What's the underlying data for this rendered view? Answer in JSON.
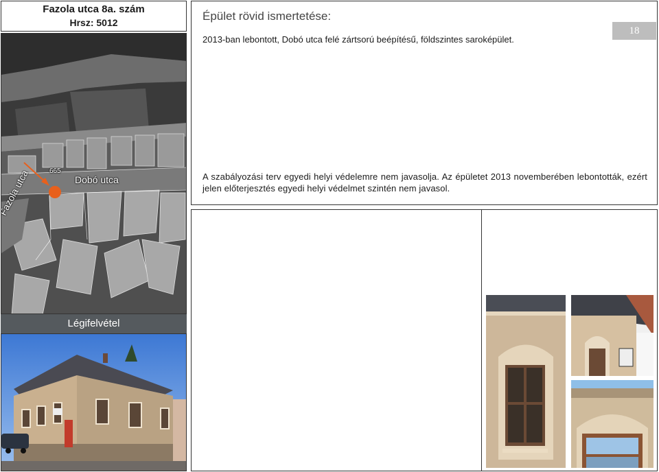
{
  "header": {
    "address": "Fazola utca 8a. szám",
    "lot_number": "Hrsz: 5012"
  },
  "aerial": {
    "labels": {
      "street_dobo": "Dobó utca",
      "street_fazola": "Fazola utca",
      "parcel_665": "665"
    },
    "caption": "Légifelvétel",
    "marker_color": "#e8601c"
  },
  "description": {
    "heading": "Épület rövid ismertetése:",
    "text": "2013-ban lebontott, Dobó utca felé zártsorú beépítésű, földszintes saroképület.",
    "page_number": "18",
    "protection_text": "A szabályozási terv egyedi helyi védelemre nem javasolja. Az épületet 2013 novemberében lebontották, ezért jelen előterjesztés egyedi helyi védelmet szintén nem javasol."
  }
}
